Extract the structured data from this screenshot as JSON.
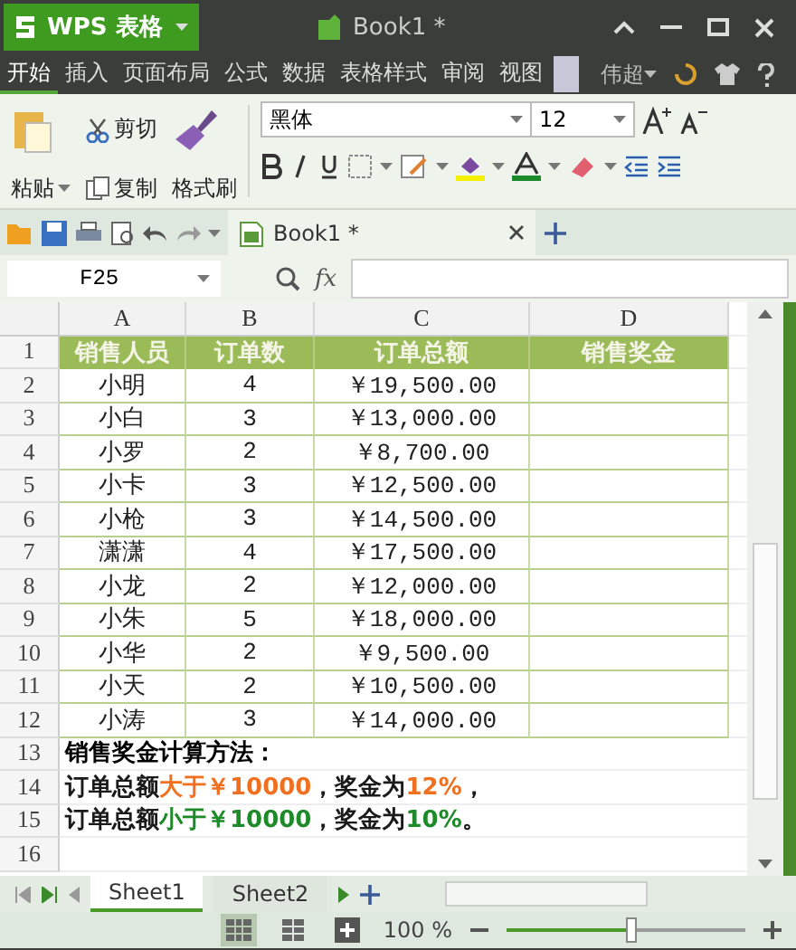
{
  "title_bar": {
    "app_button": "WPS 表格",
    "document_title": "Book1 *"
  },
  "menu": [
    {
      "label": "开始",
      "selected": true
    },
    {
      "label": "插入",
      "selected": false
    },
    {
      "label": "页面布局",
      "selected": false
    },
    {
      "label": "公式",
      "selected": false
    },
    {
      "label": "数据",
      "selected": false
    },
    {
      "label": "表格样式",
      "selected": false
    },
    {
      "label": "审阅",
      "selected": false
    },
    {
      "label": "视图",
      "selected": false
    }
  ],
  "user": "伟超",
  "ribbon": {
    "paste": "粘贴",
    "cut": "剪切",
    "copy": "复制",
    "format_painter": "格式刷",
    "font_name": "黑体",
    "font_size": "12"
  },
  "doc_tab": {
    "title": "Book1 *"
  },
  "formula_bar": {
    "name_box": "F25",
    "fx": "fx"
  },
  "columns": [
    "A",
    "B",
    "C",
    "D"
  ],
  "header_row": {
    "number": "1",
    "cells": [
      "销售人员",
      "订单数",
      "订单总额",
      "销售奖金"
    ]
  },
  "rows": [
    {
      "number": "2",
      "cells": [
        "小明",
        "4",
        "￥19,500.00"
      ]
    },
    {
      "number": "3",
      "cells": [
        "小白",
        "3",
        "￥13,000.00"
      ]
    },
    {
      "number": "4",
      "cells": [
        "小罗",
        "2",
        "￥8,700.00"
      ]
    },
    {
      "number": "5",
      "cells": [
        "小卡",
        "3",
        "￥12,500.00"
      ]
    },
    {
      "number": "6",
      "cells": [
        "小枪",
        "3",
        "￥14,500.00"
      ]
    },
    {
      "number": "7",
      "cells": [
        "潇潇",
        "4",
        "￥17,500.00"
      ]
    },
    {
      "number": "8",
      "cells": [
        "小龙",
        "2",
        "￥12,000.00"
      ]
    },
    {
      "number": "9",
      "cells": [
        "小朱",
        "5",
        "￥18,000.00"
      ]
    },
    {
      "number": "10",
      "cells": [
        "小华",
        "2",
        "￥9,500.00"
      ]
    },
    {
      "number": "11",
      "cells": [
        "小天",
        "2",
        "￥10,500.00"
      ]
    },
    {
      "number": "12",
      "cells": [
        "小涛",
        "3",
        "￥14,000.00"
      ]
    }
  ],
  "notes": {
    "title_number": "13",
    "title": "销售奖金计算方法：",
    "rules": [
      {
        "number": "14",
        "segments": [
          {
            "text": "订单总额",
            "color": "#1a1a1a"
          },
          {
            "text": "大于￥10000",
            "color": "#f07020"
          },
          {
            "text": "，奖金为",
            "color": "#1a1a1a"
          },
          {
            "text": "12%",
            "color": "#f07020"
          },
          {
            "text": "，",
            "color": "#1a1a1a"
          }
        ]
      },
      {
        "number": "15",
        "segments": [
          {
            "text": "订单总额",
            "color": "#1a1a1a"
          },
          {
            "text": "小于￥10000",
            "color": "#1f8a2a"
          },
          {
            "text": "，奖金为",
            "color": "#1a1a1a"
          },
          {
            "text": "10%",
            "color": "#1f8a2a"
          },
          {
            "text": "。",
            "color": "#1a1a1a"
          }
        ]
      }
    ],
    "empty_row_number": "16"
  },
  "sheet_tabs": [
    {
      "label": "Sheet1",
      "selected": true
    },
    {
      "label": "Sheet2",
      "selected": false
    }
  ],
  "status_bar": {
    "zoom_label": "100 %",
    "level": 0.52
  }
}
